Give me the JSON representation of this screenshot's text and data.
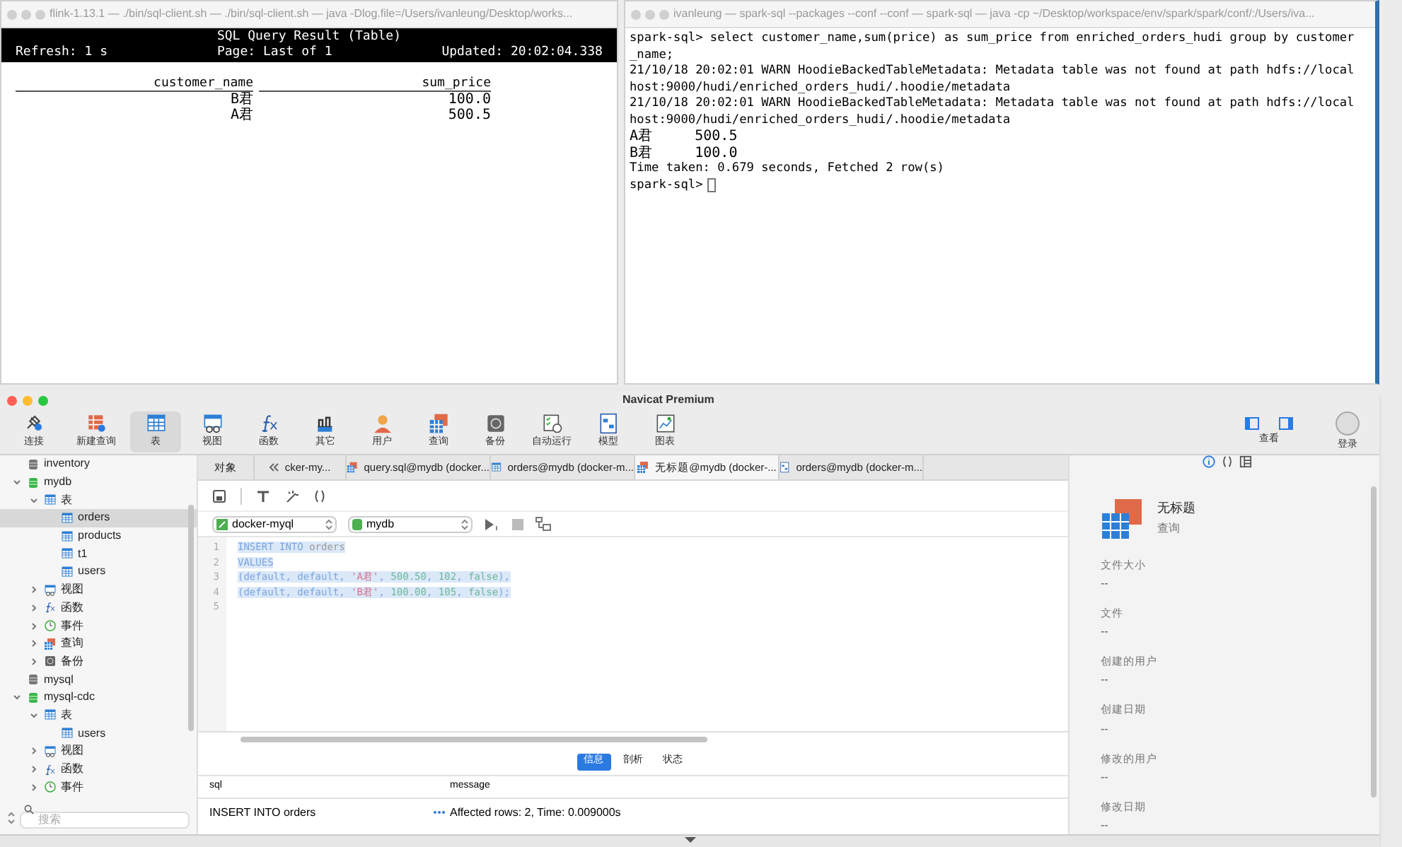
{
  "flink_terminal": {
    "title": "flink-1.13.1 — ./bin/sql-client.sh — ./bin/sql-client.sh — java -Dlog.file=/Users/ivanleung/Desktop/works...",
    "header_title": "SQL Query Result (Table)",
    "refresh": "Refresh: 1 s",
    "page": "Page: Last of 1",
    "updated": "Updated: 20:02:04.338",
    "columns": [
      "customer_name",
      "sum_price"
    ],
    "rows": [
      [
        "B君",
        "100.0"
      ],
      [
        "A君",
        "500.5"
      ]
    ]
  },
  "spark_terminal": {
    "title": "ivanleung — spark-sql --packages  --conf  --conf  — spark-sql — java -cp ~/Desktop/workspace/env/spark/spark/conf/:/Users/iva...",
    "lines": [
      {
        "kind": "text",
        "text": "spark-sql> select customer_name,sum(price) as sum_price from enriched_orders_hudi group by customer"
      },
      {
        "kind": "text",
        "text": "_name;"
      },
      {
        "kind": "text",
        "text": "21/10/18 20:02:01 WARN HoodieBackedTableMetadata: Metadata table was not found at path hdfs://local"
      },
      {
        "kind": "text",
        "text": "host:9000/hudi/enriched_orders_hudi/.hoodie/metadata"
      },
      {
        "kind": "text",
        "text": "21/10/18 20:02:01 WARN HoodieBackedTableMetadata: Metadata table was not found at path hdfs://local"
      },
      {
        "kind": "text",
        "text": "host:9000/hudi/enriched_orders_hudi/.hoodie/metadata"
      },
      {
        "kind": "result",
        "text": "A君     500.5"
      },
      {
        "kind": "result",
        "text": "B君     100.0"
      },
      {
        "kind": "text",
        "text": "Time taken: 0.679 seconds, Fetched 2 row(s)"
      },
      {
        "kind": "prompt",
        "text": "spark-sql>"
      }
    ]
  },
  "navicat": {
    "title": "Navicat Premium",
    "toolbar": [
      {
        "kind": "connect",
        "label": "连接",
        "selected": false
      },
      {
        "kind": "newquery",
        "label": "新建查询",
        "selected": false
      },
      {
        "kind": "table",
        "label": "表",
        "selected": true
      },
      {
        "kind": "view",
        "label": "视图",
        "selected": false
      },
      {
        "kind": "function",
        "label": "函数",
        "selected": false
      },
      {
        "kind": "other",
        "label": "其它",
        "selected": false
      },
      {
        "kind": "user",
        "label": "用户",
        "selected": false
      },
      {
        "kind": "query",
        "label": "查询",
        "selected": false
      },
      {
        "kind": "backup",
        "label": "备份",
        "selected": false
      },
      {
        "kind": "auto",
        "label": "自动运行",
        "selected": false
      },
      {
        "kind": "model",
        "label": "模型",
        "selected": false
      },
      {
        "kind": "chart",
        "label": "图表",
        "selected": false
      }
    ],
    "toolbar_right": [
      {
        "kind": "view-toggle",
        "label": "查看"
      },
      {
        "kind": "login",
        "label": "登录"
      }
    ],
    "tree": [
      {
        "kind": "db",
        "label": "inventory",
        "selected": false
      },
      {
        "kind": "db-open",
        "label": "mydb",
        "selected": false,
        "expanded": true,
        "children": [
          {
            "kind": "tables",
            "label": "表",
            "selected": false,
            "expanded": true,
            "children": [
              {
                "kind": "table",
                "label": "orders",
                "selected": true
              },
              {
                "kind": "table",
                "label": "products",
                "selected": false
              },
              {
                "kind": "table",
                "label": "t1",
                "selected": false
              },
              {
                "kind": "table",
                "label": "users",
                "selected": false
              }
            ]
          },
          {
            "kind": "views",
            "label": "视图",
            "selected": false,
            "expanded": false
          },
          {
            "kind": "functions",
            "label": "函数",
            "selected": false,
            "expanded": false
          },
          {
            "kind": "events",
            "label": "事件",
            "selected": false,
            "expanded": false
          },
          {
            "kind": "queries",
            "label": "查询",
            "selected": false,
            "expanded": false
          },
          {
            "kind": "backups",
            "label": "备份",
            "selected": false,
            "expanded": false
          }
        ]
      },
      {
        "kind": "db",
        "label": "mysql",
        "selected": false
      },
      {
        "kind": "db-open",
        "label": "mysql-cdc",
        "selected": false,
        "expanded": true,
        "children": [
          {
            "kind": "tables",
            "label": "表",
            "selected": false,
            "expanded": true,
            "children": [
              {
                "kind": "table",
                "label": "users",
                "selected": false
              }
            ]
          },
          {
            "kind": "views",
            "label": "视图",
            "selected": false,
            "expanded": false
          },
          {
            "kind": "functions",
            "label": "函数",
            "selected": false,
            "expanded": false
          },
          {
            "kind": "events",
            "label": "事件",
            "selected": false,
            "expanded": false
          }
        ]
      }
    ],
    "search": {
      "placeholder": "搜索"
    },
    "tabs": [
      {
        "kind": "objects",
        "label": "对象",
        "selected": false
      },
      {
        "kind": "back",
        "label": "cker-my...",
        "selected": false
      },
      {
        "kind": "query",
        "label": "query.sql@mydb (docker...",
        "selected": false
      },
      {
        "kind": "table",
        "label": "orders@mydb (docker-m...",
        "selected": false
      },
      {
        "kind": "query",
        "label": "无标题@mydb (docker-...",
        "selected": true
      },
      {
        "kind": "design",
        "label": "orders@mydb (docker-m...",
        "selected": false
      }
    ],
    "connection": "docker-myql",
    "database": "mydb",
    "editor_lines": [
      {
        "number": "1",
        "tokens": [
          {
            "kind": "keyword",
            "text": "INSERT INTO"
          },
          {
            "kind": "plain",
            "text": " orders"
          }
        ]
      },
      {
        "number": "2",
        "tokens": [
          {
            "kind": "keyword",
            "text": "VALUES"
          }
        ]
      },
      {
        "number": "3",
        "tokens": [
          {
            "kind": "keyword",
            "text": "(default, default, "
          },
          {
            "kind": "string",
            "text": "'A君'"
          },
          {
            "kind": "keyword",
            "text": ", "
          },
          {
            "kind": "number",
            "text": "500.50"
          },
          {
            "kind": "keyword",
            "text": ", "
          },
          {
            "kind": "number",
            "text": "102"
          },
          {
            "kind": "keyword",
            "text": ", "
          },
          {
            "kind": "number",
            "text": "false"
          },
          {
            "kind": "keyword",
            "text": "),"
          }
        ]
      },
      {
        "number": "4",
        "tokens": [
          {
            "kind": "keyword",
            "text": "(default, default, "
          },
          {
            "kind": "string",
            "text": "'B君'"
          },
          {
            "kind": "keyword",
            "text": ", "
          },
          {
            "kind": "number",
            "text": "100.00"
          },
          {
            "kind": "keyword",
            "text": ", "
          },
          {
            "kind": "number",
            "text": "105"
          },
          {
            "kind": "keyword",
            "text": ", "
          },
          {
            "kind": "number",
            "text": "false"
          },
          {
            "kind": "keyword",
            "text": ");"
          }
        ]
      },
      {
        "number": "5"
      }
    ],
    "result_tabs": [
      {
        "label": "信息",
        "selected": true
      },
      {
        "label": "剖析",
        "selected": false
      },
      {
        "label": "状态",
        "selected": false
      }
    ],
    "result_columns": [
      "sql",
      "message"
    ],
    "result_rows": [
      [
        "INSERT INTO orders",
        "Affected rows: 2, Time: 0.009000s"
      ]
    ],
    "info": {
      "title": "无标题",
      "subtitle": "查询",
      "fields": [
        {
          "label": "文件大小",
          "value": "--"
        },
        {
          "label": "文件",
          "value": "--"
        },
        {
          "label": "创建的用户",
          "value": "--"
        },
        {
          "label": "创建日期",
          "value": "--"
        },
        {
          "label": "修改的用户",
          "value": "--"
        },
        {
          "label": "修改日期",
          "value": "--"
        }
      ]
    }
  }
}
